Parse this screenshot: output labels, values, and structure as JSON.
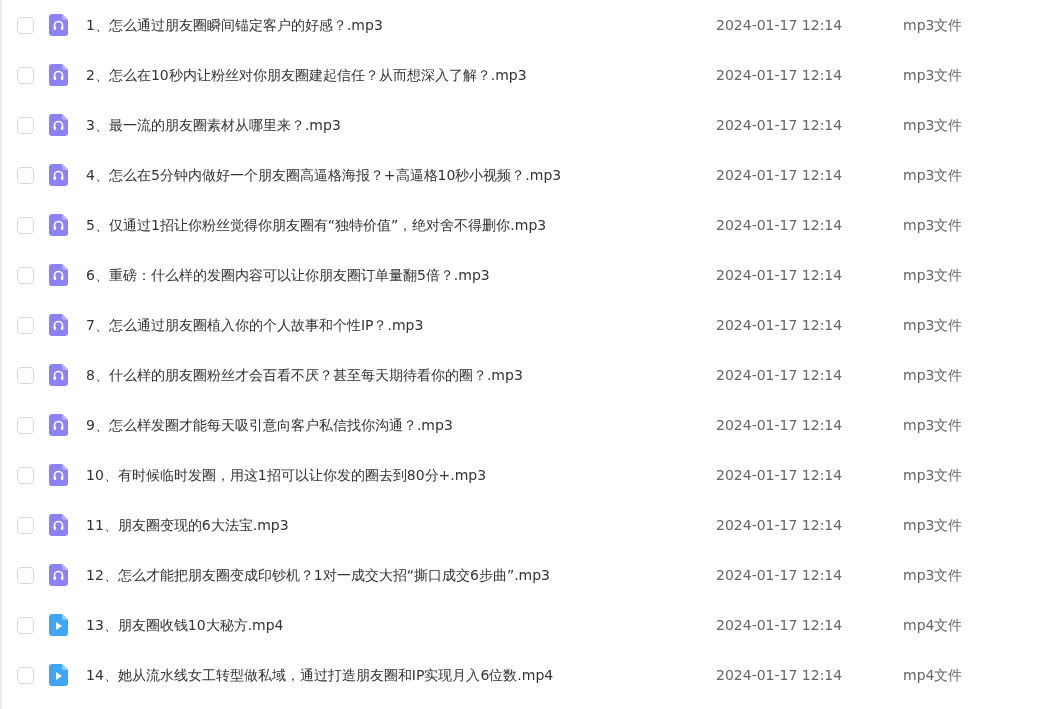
{
  "files": [
    {
      "kind": "audio",
      "name": "1、怎么通过朋友圈瞬间锚定客户的好感？.mp3",
      "modified": "2024-01-17 12:14",
      "type": "mp3文件",
      "checked": false
    },
    {
      "kind": "audio",
      "name": "2、怎么在10秒内让粉丝对你朋友圈建起信任？从而想深入了解？.mp3",
      "modified": "2024-01-17 12:14",
      "type": "mp3文件",
      "checked": false
    },
    {
      "kind": "audio",
      "name": "3、最一流的朋友圈素材从哪里来？.mp3",
      "modified": "2024-01-17 12:14",
      "type": "mp3文件",
      "checked": false
    },
    {
      "kind": "audio",
      "name": "4、怎么在5分钟内做好一个朋友圈高逼格海报？+高逼格10秒小视频？.mp3",
      "modified": "2024-01-17 12:14",
      "type": "mp3文件",
      "checked": false
    },
    {
      "kind": "audio",
      "name": "5、仅通过1招让你粉丝觉得你朋友圈有“独特价值”，绝对舍不得删你.mp3",
      "modified": "2024-01-17 12:14",
      "type": "mp3文件",
      "checked": false
    },
    {
      "kind": "audio",
      "name": "6、重磅：什么样的发圈内容可以让你朋友圈订单量翻5倍？.mp3",
      "modified": "2024-01-17 12:14",
      "type": "mp3文件",
      "checked": false
    },
    {
      "kind": "audio",
      "name": "7、怎么通过朋友圈植入你的个人故事和个性IP？.mp3",
      "modified": "2024-01-17 12:14",
      "type": "mp3文件",
      "checked": false
    },
    {
      "kind": "audio",
      "name": "8、什么样的朋友圈粉丝才会百看不厌？甚至每天期待看你的圈？.mp3",
      "modified": "2024-01-17 12:14",
      "type": "mp3文件",
      "checked": false
    },
    {
      "kind": "audio",
      "name": "9、怎么样发圈才能每天吸引意向客户私信找你沟通？.mp3",
      "modified": "2024-01-17 12:14",
      "type": "mp3文件",
      "checked": false
    },
    {
      "kind": "audio",
      "name": "10、有时候临时发圈，用这1招可以让你发的圈去到80分+.mp3",
      "modified": "2024-01-17 12:14",
      "type": "mp3文件",
      "checked": false
    },
    {
      "kind": "audio",
      "name": "11、朋友圈变现的6大法宝.mp3",
      "modified": "2024-01-17 12:14",
      "type": "mp3文件",
      "checked": false
    },
    {
      "kind": "audio",
      "name": "12、怎么才能把朋友圈变成印钞机？1对一成交大招“撕口成交6步曲”.mp3",
      "modified": "2024-01-17 12:14",
      "type": "mp3文件",
      "checked": false
    },
    {
      "kind": "video",
      "name": "13、朋友圈收钱10大秘方.mp4",
      "modified": "2024-01-17 12:14",
      "type": "mp4文件",
      "checked": false
    },
    {
      "kind": "video",
      "name": "14、她从流水线女工转型做私域，通过打造朋友圈和IP实现月入6位数.mp4",
      "modified": "2024-01-17 12:14",
      "type": "mp4文件",
      "checked": false
    }
  ]
}
